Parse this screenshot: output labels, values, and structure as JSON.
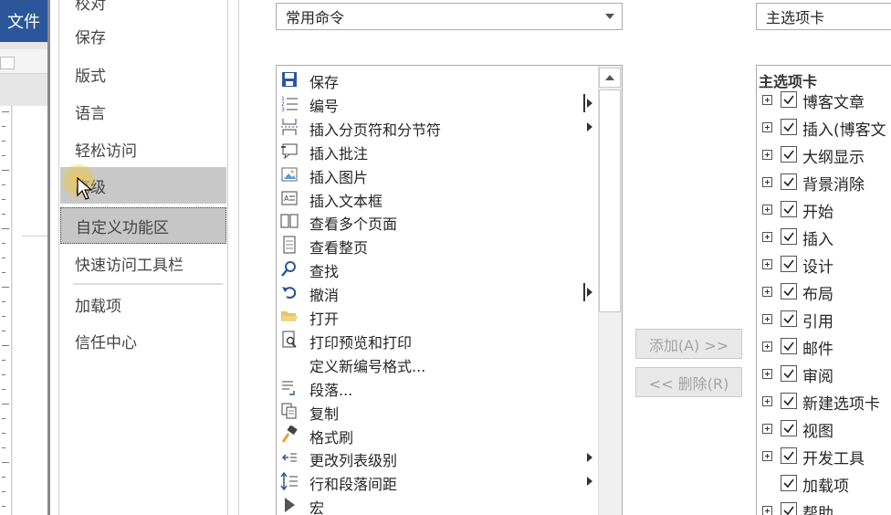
{
  "word": {
    "file_tab": "文件"
  },
  "nav": {
    "partial_top": "校对",
    "items": [
      {
        "label": "保存",
        "state": "normal"
      },
      {
        "label": "版式",
        "state": "normal"
      },
      {
        "label": "语言",
        "state": "normal"
      },
      {
        "label": "轻松访问",
        "state": "normal"
      },
      {
        "label": "高级",
        "state": "hover"
      },
      {
        "label": "自定义功能区",
        "state": "selected"
      },
      {
        "label": "快速访问工具栏",
        "state": "normal"
      },
      {
        "label": "加载项",
        "state": "normal"
      },
      {
        "label": "信任中心",
        "state": "normal"
      }
    ]
  },
  "commands_dropdown": {
    "selected": "常用命令"
  },
  "tabs_dropdown": {
    "selected": "主选项卡"
  },
  "commands": [
    {
      "label": "保存",
      "icon": "save-icon"
    },
    {
      "label": "编号",
      "icon": "numbering-icon",
      "split": true
    },
    {
      "label": "插入分页符和分节符",
      "icon": "page-break-icon",
      "submenu": true
    },
    {
      "label": "插入批注",
      "icon": "comment-icon"
    },
    {
      "label": "插入图片",
      "icon": "picture-icon"
    },
    {
      "label": "插入文本框",
      "icon": "textbox-icon"
    },
    {
      "label": "查看多个页面",
      "icon": "multiple-pages-icon"
    },
    {
      "label": "查看整页",
      "icon": "whole-page-icon"
    },
    {
      "label": "查找",
      "icon": "find-icon"
    },
    {
      "label": "撤消",
      "icon": "undo-icon",
      "split": true
    },
    {
      "label": "打开",
      "icon": "open-folder-icon"
    },
    {
      "label": "打印预览和打印",
      "icon": "print-preview-icon"
    },
    {
      "label": "定义新编号格式...",
      "icon": ""
    },
    {
      "label": "段落...",
      "icon": "paragraph-icon"
    },
    {
      "label": "复制",
      "icon": "copy-icon"
    },
    {
      "label": "格式刷",
      "icon": "format-painter-icon"
    },
    {
      "label": "更改列表级别",
      "icon": "list-level-icon",
      "submenu": true
    },
    {
      "label": "行和段落间距",
      "icon": "line-spacing-icon",
      "submenu": true
    },
    {
      "label": "宏",
      "icon": "macro-icon"
    }
  ],
  "buttons": {
    "add": "添加(A) >>",
    "remove": "<< 删除(R)"
  },
  "tabs_tree": {
    "title": "主选项卡",
    "items": [
      {
        "label": "博客文章",
        "expandable": true,
        "checked": true
      },
      {
        "label": "插入(博客文",
        "expandable": true,
        "checked": true
      },
      {
        "label": "大纲显示",
        "expandable": true,
        "checked": true
      },
      {
        "label": "背景消除",
        "expandable": true,
        "checked": true
      },
      {
        "label": "开始",
        "expandable": true,
        "checked": true
      },
      {
        "label": "插入",
        "expandable": true,
        "checked": true
      },
      {
        "label": "设计",
        "expandable": true,
        "checked": true
      },
      {
        "label": "布局",
        "expandable": true,
        "checked": true
      },
      {
        "label": "引用",
        "expandable": true,
        "checked": true
      },
      {
        "label": "邮件",
        "expandable": true,
        "checked": true
      },
      {
        "label": "审阅",
        "expandable": true,
        "checked": true
      },
      {
        "label": "新建选项卡",
        "expandable": true,
        "checked": true
      },
      {
        "label": "视图",
        "expandable": true,
        "checked": true
      },
      {
        "label": "开发工具",
        "expandable": true,
        "checked": true
      },
      {
        "label": "加载项",
        "expandable": false,
        "checked": true
      },
      {
        "label": "帮助",
        "expandable": true,
        "checked": true
      }
    ]
  },
  "colors": {
    "word_blue": "#2b579a",
    "nav_selected": "#c6c6c6",
    "disabled_text": "#a3a3a3"
  }
}
